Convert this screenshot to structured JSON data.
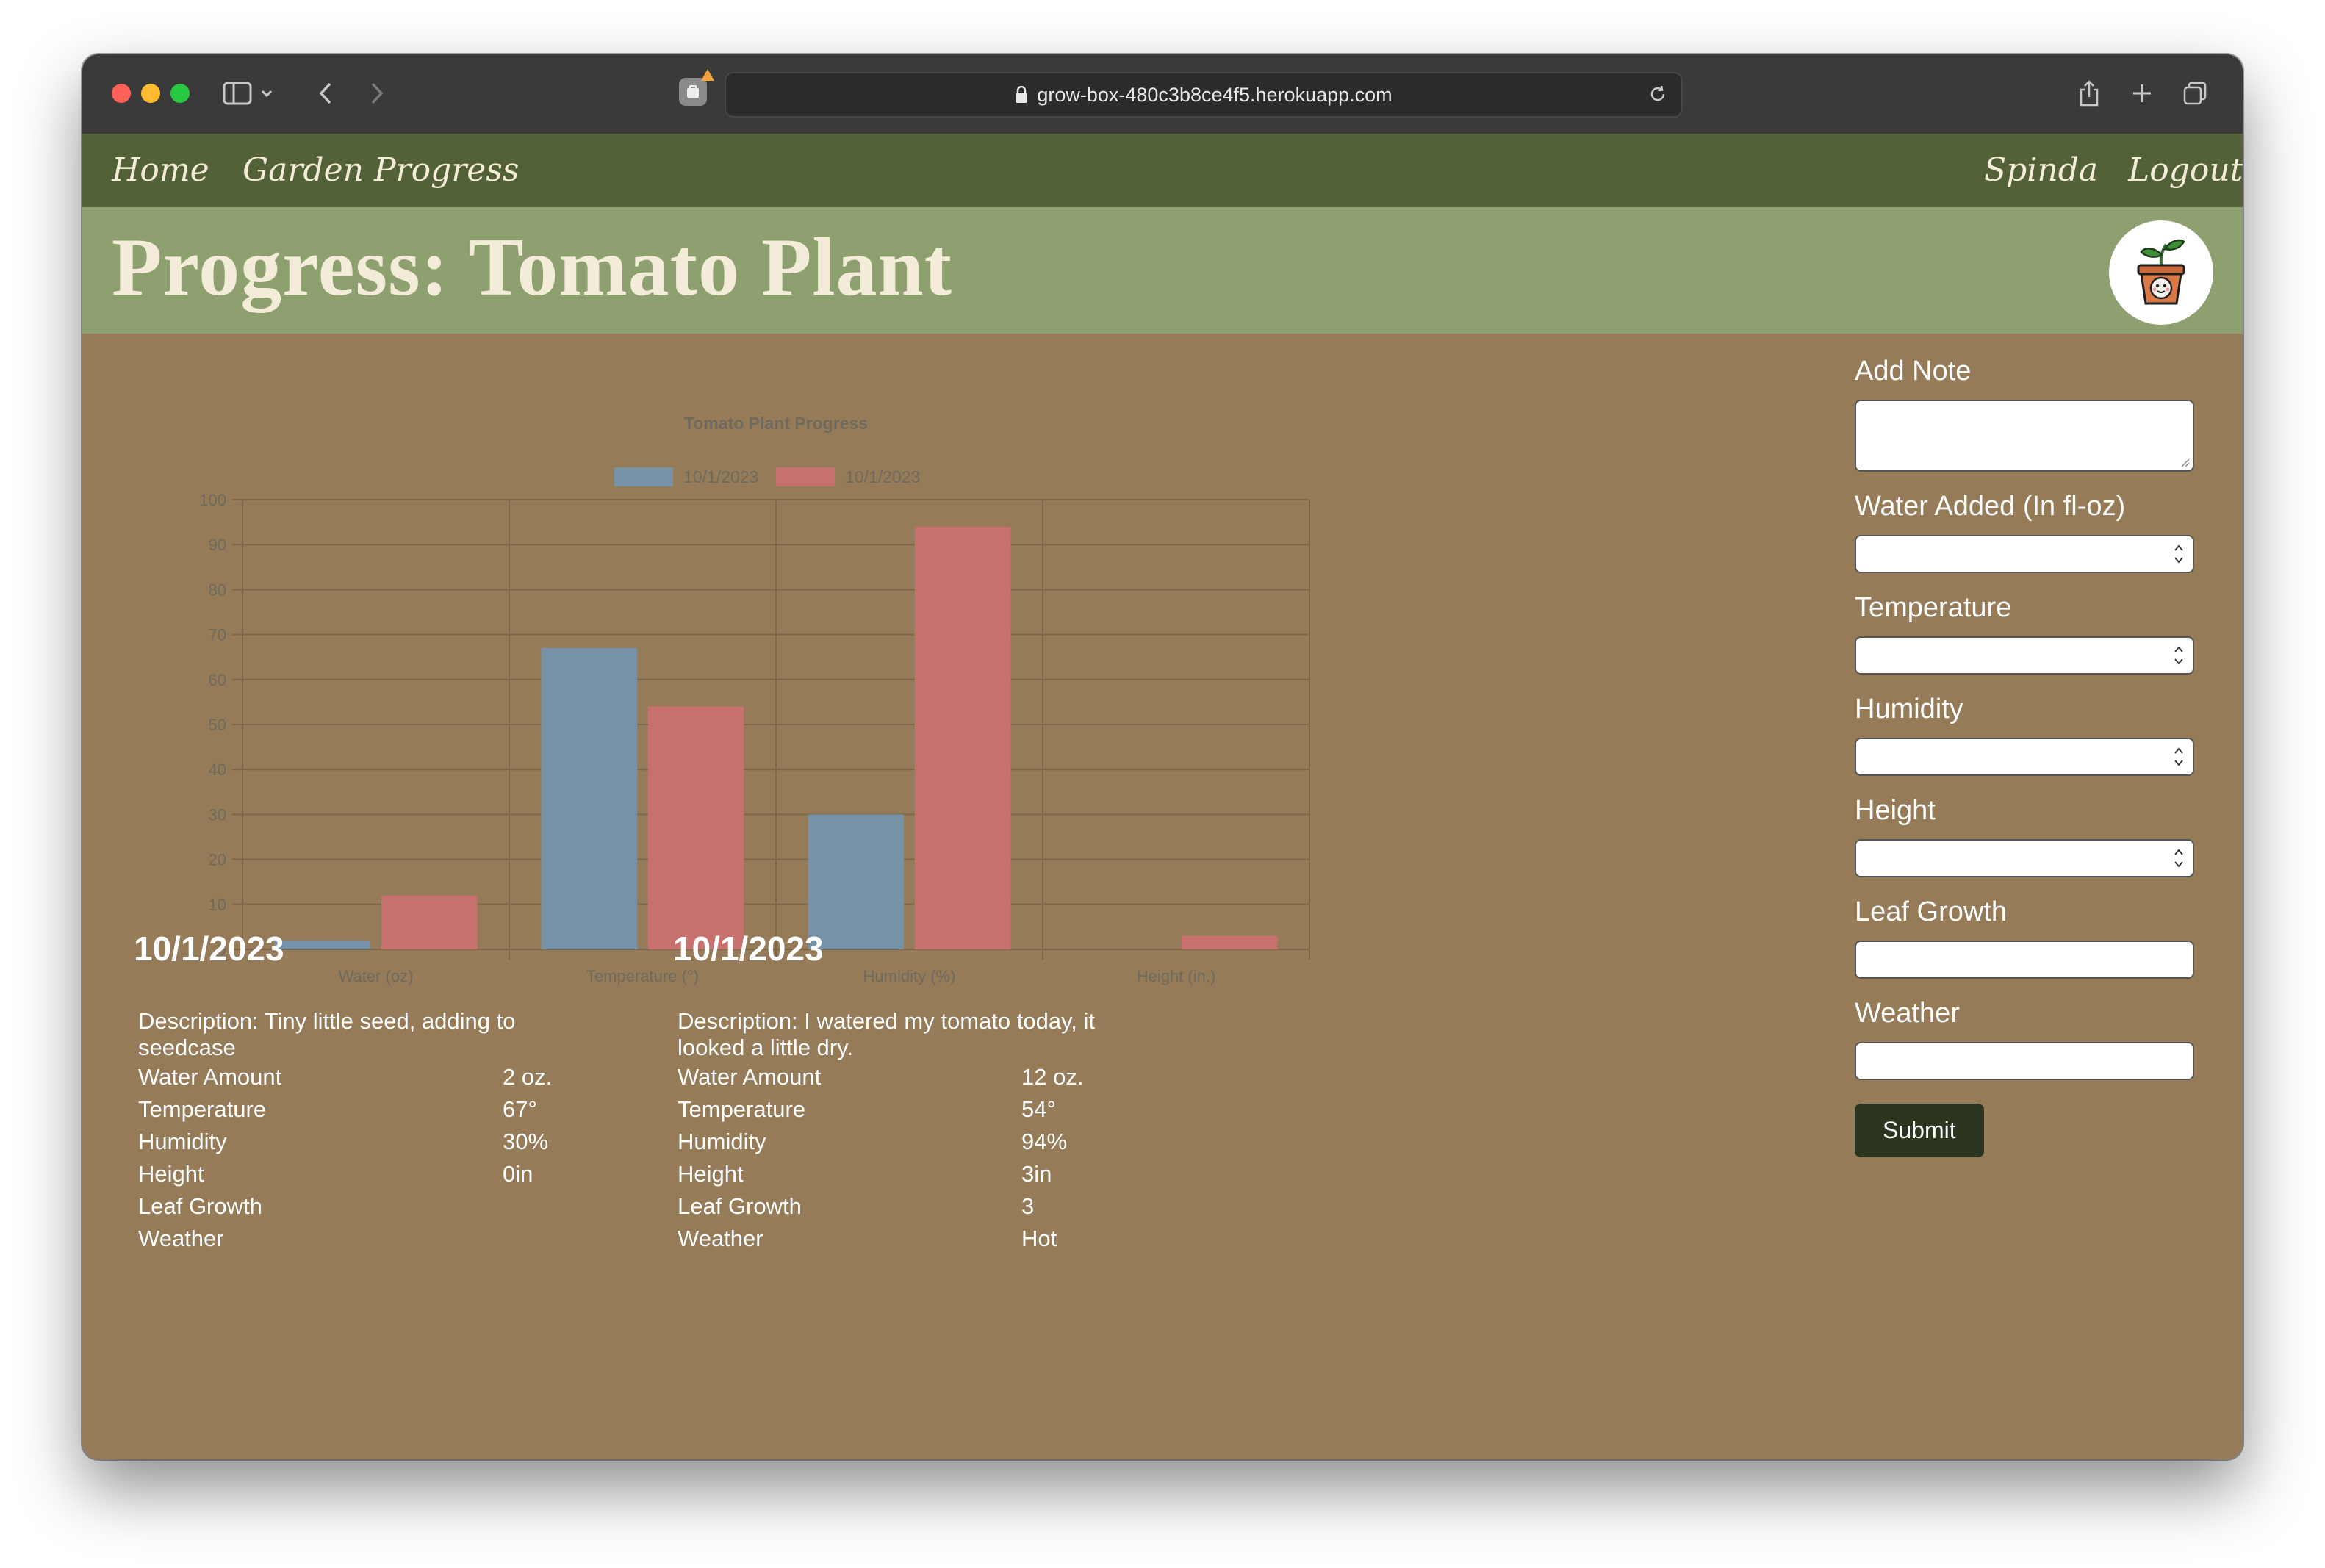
{
  "browser": {
    "url": "grow-box-480c3b8ce4f5.herokuapp.com"
  },
  "nav": {
    "home": "Home",
    "garden_progress": "Garden Progress",
    "user": "Spinda",
    "logout": "Logout"
  },
  "header": {
    "title": "Progress: Tomato Plant",
    "logo_icon": "potted-sprout-icon"
  },
  "chart_data": {
    "type": "bar",
    "title": "Tomato Plant Progress",
    "categories": [
      "Water (oz)",
      "Temperature (°)",
      "Humidity (%)",
      "Height (in.)"
    ],
    "series": [
      {
        "name": "10/1/2023",
        "values": [
          2,
          67,
          30,
          0
        ],
        "color": "#7592a6"
      },
      {
        "name": "10/1/2023",
        "values": [
          12,
          54,
          94,
          3
        ],
        "color": "#c6716e"
      }
    ],
    "y_ticks": [
      "0",
      "10",
      "20",
      "30",
      "40",
      "50",
      "60",
      "70",
      "80",
      "90",
      "100"
    ],
    "ylim": [
      0,
      100
    ],
    "legend_position": "top",
    "grid": true
  },
  "entries": [
    {
      "date": "10/1/2023",
      "description": "Description: Tiny little seed, adding to seedcase",
      "rows": [
        {
          "label": "Water Amount",
          "value": "2 oz."
        },
        {
          "label": "Temperature",
          "value": "67°"
        },
        {
          "label": "Humidity",
          "value": "30%"
        },
        {
          "label": "Height",
          "value": "0in"
        },
        {
          "label": "Leaf Growth",
          "value": ""
        },
        {
          "label": "Weather",
          "value": ""
        }
      ]
    },
    {
      "date": "10/1/2023",
      "description": "Description: I watered my tomato today, it looked a little dry.",
      "rows": [
        {
          "label": "Water Amount",
          "value": "12 oz."
        },
        {
          "label": "Temperature",
          "value": "54°"
        },
        {
          "label": "Humidity",
          "value": "94%"
        },
        {
          "label": "Height",
          "value": "3in"
        },
        {
          "label": "Leaf Growth",
          "value": "3"
        },
        {
          "label": "Weather",
          "value": "Hot"
        }
      ]
    }
  ],
  "form": {
    "add_note": "Add Note",
    "water_added": "Water Added (In fl-oz)",
    "temperature": "Temperature",
    "humidity": "Humidity",
    "height": "Height",
    "leaf_growth": "Leaf Growth",
    "weather": "Weather",
    "submit": "Submit"
  },
  "colors": {
    "navbar": "#526138",
    "header": "#8fa070",
    "page_bg": "#957b57",
    "submit": "#2b3520"
  }
}
